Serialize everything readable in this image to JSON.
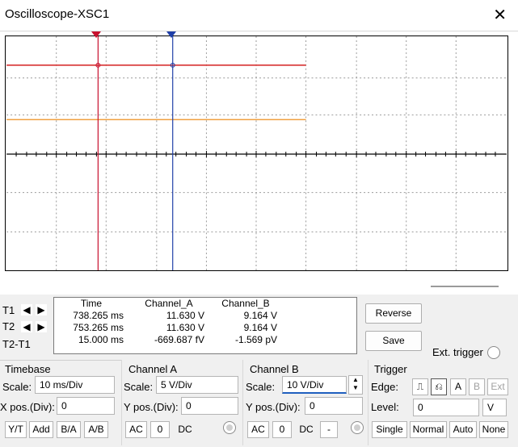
{
  "window": {
    "title": "Oscilloscope-XSC1",
    "close_glyph": "✕"
  },
  "cursors": {
    "t1_marker": "1",
    "t2_marker": "2"
  },
  "measurements": {
    "headers": [
      "Time",
      "Channel_A",
      "Channel_B"
    ],
    "rows": [
      {
        "label": "T1",
        "time": "738.265 ms",
        "a": "11.630 V",
        "b": "9.164 V"
      },
      {
        "label": "T2",
        "time": "753.265 ms",
        "a": "11.630 V",
        "b": "9.164 V"
      },
      {
        "label": "T2-T1",
        "time": "15.000 ms",
        "a": "-669.687 fV",
        "b": "-1.569 pV"
      }
    ]
  },
  "buttons": {
    "reverse": "Reverse",
    "save": "Save",
    "ext_trigger": "Ext. trigger"
  },
  "timebase": {
    "title": "Timebase",
    "scale_label": "Scale:",
    "scale_value": "10 ms/Div",
    "xpos_label": "X pos.(Div):",
    "xpos_value": "0",
    "modes": [
      "Y/T",
      "Add",
      "B/A",
      "A/B"
    ]
  },
  "channel_a": {
    "title": "Channel A",
    "scale_label": "Scale:",
    "scale_value": "5  V/Div",
    "ypos_label": "Y pos.(Div):",
    "ypos_value": "0",
    "coupling": [
      "AC",
      "0",
      "DC"
    ]
  },
  "channel_b": {
    "title": "Channel B",
    "scale_label": "Scale:",
    "scale_value": "10  V/Div",
    "ypos_label": "Y pos.(Div):",
    "ypos_value": "0",
    "coupling": [
      "AC",
      "0",
      "DC",
      "-"
    ]
  },
  "trigger": {
    "title": "Trigger",
    "edge_label": "Edge:",
    "edge_buttons": [
      "A",
      "B",
      "Ext"
    ],
    "level_label": "Level:",
    "level_value": "0",
    "level_unit": "V",
    "modes": [
      "Single",
      "Normal",
      "Auto",
      "None"
    ]
  },
  "colors": {
    "channel_a_trace": "#d42020",
    "channel_b_trace": "#f0a040",
    "cursor1": "#c8102e",
    "cursor2": "#1f3fa8"
  }
}
